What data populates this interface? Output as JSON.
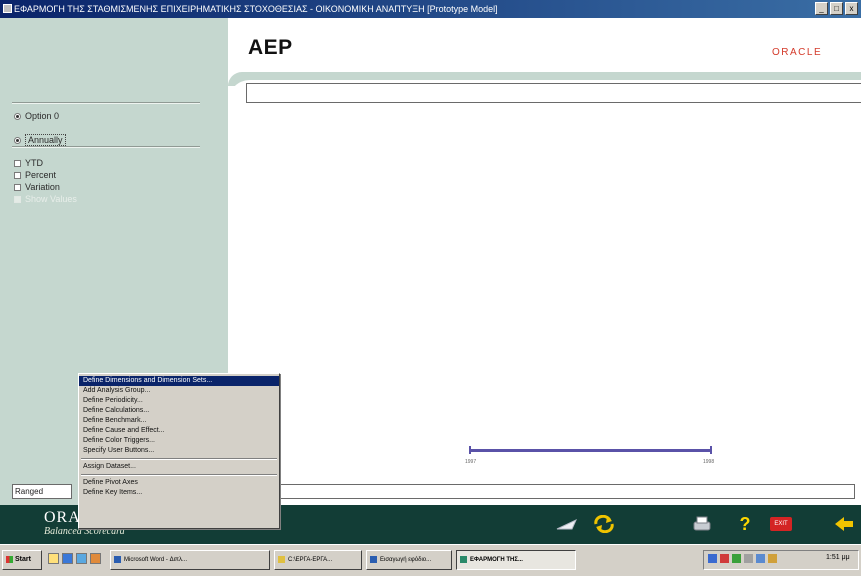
{
  "window": {
    "title": "ΕΦΑΡΜΟΓΗ ΤΗΣ ΣΤΑΘΜΙΣΜΕΝΗΣ ΕΠΙΧΕΙΡΗΜΑΤΙΚΗΣ ΣΤΟΧΟΘΕΣΙΑΣ - ΟΙΚΟΝΟΜΙΚΗ ΑΝΑΠΤΥΞΗ [Prototype Model]",
    "controls": [
      "_",
      "□",
      "x"
    ]
  },
  "header": {
    "title": "AEP",
    "logo": "ORACLE"
  },
  "left_panel": {
    "radios": [
      {
        "label": "Option 0",
        "checked": true
      },
      {
        "label": "Annually",
        "checked": true
      }
    ],
    "checkboxes": [
      {
        "label": "YTD",
        "checked": false,
        "enabled": true
      },
      {
        "label": "Percent",
        "checked": false,
        "enabled": true
      },
      {
        "label": "Variation",
        "checked": false,
        "enabled": true
      },
      {
        "label": "Show Values",
        "checked": false,
        "enabled": false
      }
    ]
  },
  "main": {
    "input_value": "",
    "slider": {
      "start_label": "1997",
      "end_label": "1998"
    }
  },
  "status": {
    "field_value": "Ranged",
    "message_value": ""
  },
  "context_menu": {
    "items": [
      "Define Dimensions and Dimension Sets...",
      "Add Analysis Group...",
      "Define Periodicity...",
      "Define Calculations...",
      "Define Benchmark...",
      "Define Cause and Effect...",
      "Define Color Triggers...",
      "Specify User Buttons...",
      "-",
      "Assign Dataset...",
      "-",
      "Define Pivot Axes",
      "Define Key Items..."
    ],
    "selected_index": 0
  },
  "brand": {
    "name": "ORACLE",
    "subtitle": "Balanced Scorecard"
  },
  "toolbar": {
    "icons": [
      "pointer-icon",
      "refresh-icon",
      "print-icon",
      "help-icon",
      "exit-icon",
      "back-arrow-icon"
    ],
    "exit_label": "EXIT",
    "help_label": "?"
  },
  "taskbar": {
    "start_label": "Start",
    "tasks": [
      {
        "label": "Microsoft Word - Διπλ...",
        "active": false
      },
      {
        "label": "C:\\ΕΡΓΑ-ΕΡΓΑ...",
        "active": false
      },
      {
        "label": "Εισαγωγή εφόδιο...",
        "active": false
      },
      {
        "label": "ΕΦΑΡΜΟΓΗ ΤΗΣ...",
        "active": true
      }
    ],
    "clock": "1:51 μμ"
  },
  "colors": {
    "panel": "#c5d7cf",
    "toolbar": "#123d36",
    "oracle_red": "#d43a2a",
    "slider": "#5a52a8",
    "menu_highlight": "#0a246a"
  }
}
